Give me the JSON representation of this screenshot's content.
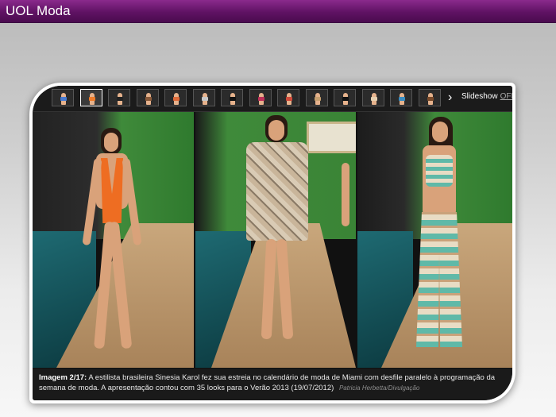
{
  "header": {
    "title": "UOL Moda"
  },
  "gallery": {
    "thumbnails": [
      {
        "swatch": "#4a7bd0"
      },
      {
        "swatch": "#ef7c2a"
      },
      {
        "swatch": "#222222"
      },
      {
        "swatch": "#8a5a3a"
      },
      {
        "swatch": "#e06b3a"
      },
      {
        "swatch": "#c8c8c8"
      },
      {
        "swatch": "#111111"
      },
      {
        "swatch": "#c0305a"
      },
      {
        "swatch": "#d04a3a"
      },
      {
        "swatch": "#c8a070"
      },
      {
        "swatch": "#111111"
      },
      {
        "swatch": "#e8d0b0"
      },
      {
        "swatch": "#3a8cc0"
      },
      {
        "swatch": "#7a4a2a"
      }
    ],
    "next_icon": "chevron-right-icon",
    "slideshow_label": "Slideshow",
    "slideshow_state": "OFF"
  },
  "caption": {
    "prefix": "Imagem 2/17:",
    "text": "A estilista brasileira Sinesia Karol fez sua estreia no calendário de moda de Miami com desfile paralelo à programação da semana de moda. A apresentação contou com 35 looks para o Verão 2013 (19/07/2012)",
    "credit": "Patricia Herbetta/Divulgação"
  },
  "colors": {
    "header_purple": "#5f1263",
    "caption_bg": "#1a1a1a",
    "swimsuit_orange": "#ee6d22",
    "hedge_green": "#3f8a3a"
  }
}
